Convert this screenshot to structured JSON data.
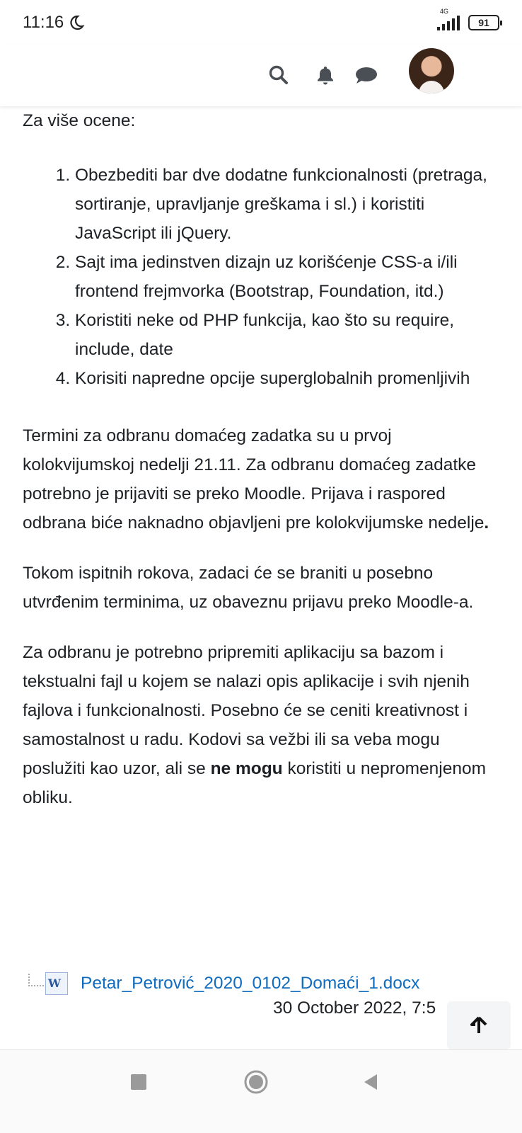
{
  "status_bar": {
    "time": "11:16",
    "network": "4G",
    "battery": "91"
  },
  "navbar": {
    "icons": [
      "search-icon",
      "bell-icon",
      "chat-icon",
      "avatar",
      "caret-down-icon"
    ]
  },
  "content": {
    "intro": "Za više ocene:",
    "list": [
      "Obezbediti bar dve dodatne funkcionalnosti (pretraga, sortiranje, upravljanje greškama i sl.) i koristiti JavaScript ili jQuery.",
      "Sajt ima jedinstven dizajn uz korišćenje CSS-a i/ili frontend frejmvorka (Bootstrap, Foundation, itd.)",
      "Koristiti neke od PHP funkcija, kao što su require, include, date",
      "Korisiti napredne opcije superglobalnih promenljivih"
    ],
    "para1": "Termini za odbranu domaćeg zadatka su u prvoj kolokvijumskoj nedelji 21.11. Za odbranu domaćeg zadatke potrebno je prijaviti se preko Moodle. Prijava i raspored odbrana biće naknadno objavljeni pre kolokvijumske nedelje",
    "para1_end": ".",
    "para2": "Tokom ispitnih rokova, zadaci će se braniti u posebno utvrđenim terminima, uz obaveznu prijavu preko Moodle-a.",
    "para3_before": "Za odbranu je potrebno pripremiti aplikaciju sa bazom i tekstualni fajl u kojem se nalazi opis aplikacije i svih njenih fajlova i funkcionalnosti. Posebno će se ceniti kreativnost i samostalnost u radu. Kodovi sa vežbi ili sa veba mogu poslužiti kao uzor, ali se ",
    "para3_bold": "ne mogu",
    "para3_after": " koristiti u nepromenjenom obliku."
  },
  "file": {
    "name": "Petar_Petrović_2020_0102_Domaći_1.docx",
    "date": "30 October 2022, 7:5",
    "icon_letter": "W"
  },
  "colors": {
    "link": "#0f6cbf",
    "caret": "#1a73c9",
    "text": "#1d2125"
  }
}
